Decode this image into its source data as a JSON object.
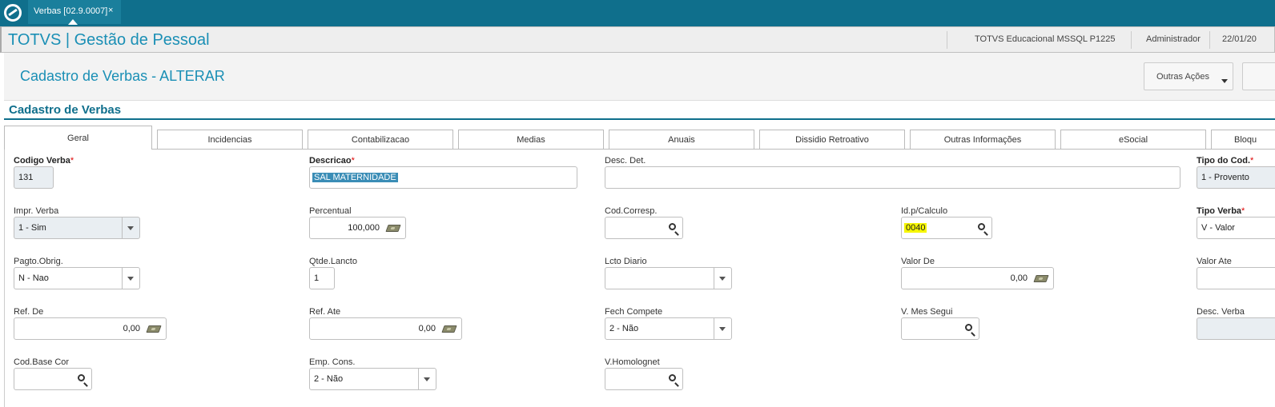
{
  "browser_tab": {
    "label": "Verbas [02.9.0007]",
    "close": "×"
  },
  "app": {
    "title": "TOTVS | Gestão de Pessoal",
    "environment": "TOTVS Educacional MSSQL P1225",
    "user": "Administrador",
    "date": "22/01/20"
  },
  "page": {
    "title": "Cadastro de Verbas - ALTERAR",
    "outras_acoes": "Outras Ações",
    "section": "Cadastro de Verbas"
  },
  "tabs": [
    "Geral",
    "Incidencias",
    "Contabilizacao",
    "Medias",
    "Anuais",
    "Dissidio Retroativo",
    "Outras Informações",
    "eSocial",
    "Bloqu"
  ],
  "fields": {
    "codigo_verba": {
      "label": "Codigo Verba",
      "req": "*",
      "value": "131"
    },
    "descricao": {
      "label": "Descricao",
      "req": "*",
      "value": "SAL MATERNIDADE"
    },
    "desc_det": {
      "label": "Desc. Det.",
      "value": ""
    },
    "tipo_cod": {
      "label": "Tipo do Cod.",
      "req": "*",
      "value": "1 - Provento"
    },
    "impr_verba": {
      "label": "Impr. Verba",
      "value": "1 - Sim"
    },
    "percentual": {
      "label": "Percentual",
      "value": "100,000"
    },
    "cod_corresp": {
      "label": "Cod.Corresp.",
      "value": ""
    },
    "id_calculo": {
      "label": "Id.p/Calculo",
      "value": "0040"
    },
    "tipo_verba": {
      "label": "Tipo Verba",
      "req": "*",
      "value": "V - Valor"
    },
    "pagto_obrig": {
      "label": "Pagto.Obrig.",
      "value": "N - Nao"
    },
    "qtde_lancto": {
      "label": "Qtde.Lancto",
      "value": "1"
    },
    "lcto_diario": {
      "label": "Lcto Diario",
      "value": ""
    },
    "valor_de": {
      "label": "Valor De",
      "value": "0,00"
    },
    "valor_ate": {
      "label": "Valor Ate",
      "value": ""
    },
    "ref_de": {
      "label": "Ref. De",
      "value": "0,00"
    },
    "ref_ate": {
      "label": "Ref. Ate",
      "value": "0,00"
    },
    "fech_compete": {
      "label": "Fech Compete",
      "value": "2 - Não"
    },
    "v_mes_segui": {
      "label": "V. Mes Segui",
      "value": ""
    },
    "desc_verba": {
      "label": "Desc. Verba",
      "value": ""
    },
    "cod_base_cor": {
      "label": "Cod.Base Cor",
      "value": ""
    },
    "emp_cons": {
      "label": "Emp. Cons.",
      "value": "2 - Não"
    },
    "v_homolognet": {
      "label": "V.Homolognet",
      "value": ""
    }
  },
  "colors": {
    "topbar": "#0f6f8c",
    "accent": "#1a8fb5",
    "highlight": "#f6f600"
  },
  "icons": [
    "totvs-logo-icon",
    "search-icon",
    "money-icon",
    "chevron-down-icon"
  ]
}
